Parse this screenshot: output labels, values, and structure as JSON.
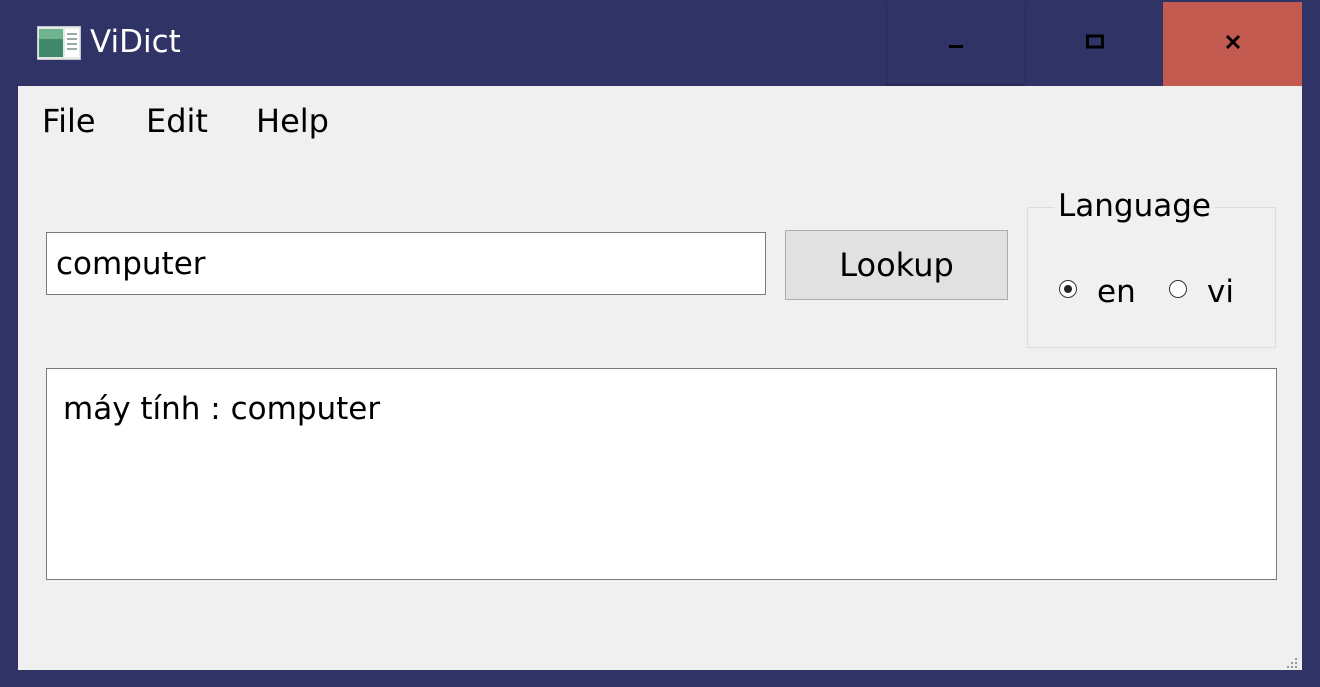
{
  "window": {
    "title": "ViDict",
    "icon": "dictionary-app-icon",
    "controls": {
      "minimize_icon": "minimize-icon",
      "maximize_icon": "maximize-icon",
      "close_icon": "close-icon",
      "close_color": "#c25a4f"
    },
    "titlebar_color": "#2f3366"
  },
  "menu": {
    "items": [
      {
        "label": "File"
      },
      {
        "label": "Edit"
      },
      {
        "label": "Help"
      }
    ]
  },
  "search": {
    "value": "computer",
    "button_label": "Lookup"
  },
  "language": {
    "group_label": "Language",
    "options": [
      {
        "label": "en",
        "checked": true
      },
      {
        "label": "vi",
        "checked": false
      }
    ]
  },
  "result": {
    "text": "máy tính : computer"
  }
}
